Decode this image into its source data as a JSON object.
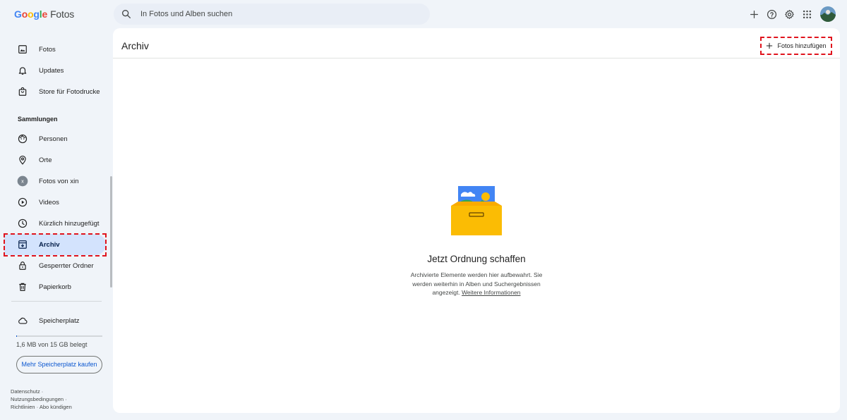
{
  "app": {
    "logo_google": "Google",
    "logo_product": "Fotos"
  },
  "search": {
    "placeholder": "In Fotos und Alben suchen"
  },
  "top_icons": [
    "plus-icon",
    "help-icon",
    "settings-icon",
    "apps-grid-icon",
    "avatar"
  ],
  "sidebar": {
    "items": [
      {
        "label": "Fotos",
        "icon": "photo-icon"
      },
      {
        "label": "Updates",
        "icon": "bell-icon"
      },
      {
        "label": "Store für Fotodrucke",
        "icon": "shopping-bag-icon"
      }
    ],
    "section_title": "Sammlungen",
    "collections": [
      {
        "label": "Personen",
        "icon": "face-icon"
      },
      {
        "label": "Orte",
        "icon": "location-pin-icon"
      },
      {
        "label": "Fotos von xin",
        "icon": "user-x-avatar",
        "avatar_letter": "x"
      },
      {
        "label": "Videos",
        "icon": "play-circle-icon"
      },
      {
        "label": "Kürzlich hinzugefügt",
        "icon": "clock-icon"
      },
      {
        "label": "Archiv",
        "icon": "archive-icon",
        "active": true
      },
      {
        "label": "Gesperrter Ordner",
        "icon": "lock-icon"
      },
      {
        "label": "Papierkorb",
        "icon": "trash-icon"
      }
    ],
    "storage": {
      "label": "Speicherplatz",
      "icon": "cloud-icon",
      "used_text": "1,6 MB von 15 GB belegt",
      "used_fraction": 0.0001
    },
    "more_storage_button": "Mehr Speicherplatz kaufen",
    "footer": {
      "privacy": "Datenschutz",
      "terms": "Nutzungsbedingungen",
      "guidelines": "Richtlinien",
      "cancel": "Abo kündigen",
      "separator": "·"
    }
  },
  "main": {
    "title": "Archiv",
    "add_button": "Fotos hinzufügen",
    "empty": {
      "title": "Jetzt Ordnung schaffen",
      "description": "Archivierte Elemente werden hier aufbewahrt. Sie werden weiterhin in Alben und Suchergebnissen angezeigt.",
      "link": "Weitere Informationen"
    }
  },
  "colors": {
    "accent": "#0b57d0",
    "active_bg": "#d3e3fd",
    "highlight_dashed": "#e0141d",
    "page_bg": "#f0f4f9"
  }
}
